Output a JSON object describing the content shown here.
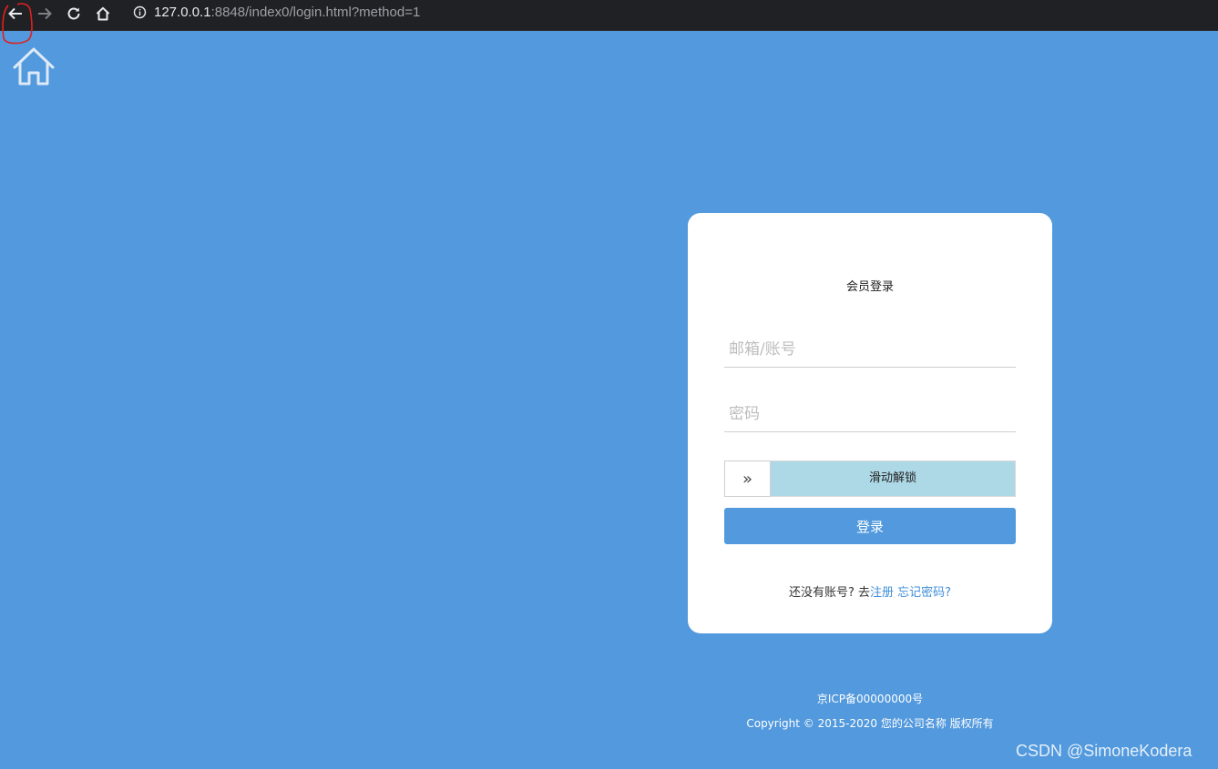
{
  "browser": {
    "url_host": "127.0.0.1",
    "url_rest": ":8848/index0/login.html?method=1",
    "icons": [
      "back-arrow-icon",
      "forward-arrow-icon",
      "reload-icon",
      "home-icon",
      "info-icon"
    ]
  },
  "page": {
    "home_icon": "home-outline-icon",
    "background_color": "#5299dd"
  },
  "login": {
    "title": "会员登录",
    "account_placeholder": "邮箱/账号",
    "password_placeholder": "密码",
    "slider_handle": "»",
    "slider_label": "滑动解锁",
    "submit_label": "登录",
    "no_account_text": "还没有账号? 去",
    "register_link": "注册",
    "forgot_link": "忘记密码?"
  },
  "footer": {
    "icp": "京ICP备00000000号",
    "copyright": "Copyright © 2015-2020 您的公司名称 版权所有"
  },
  "watermark": "CSDN @SimoneKodera"
}
